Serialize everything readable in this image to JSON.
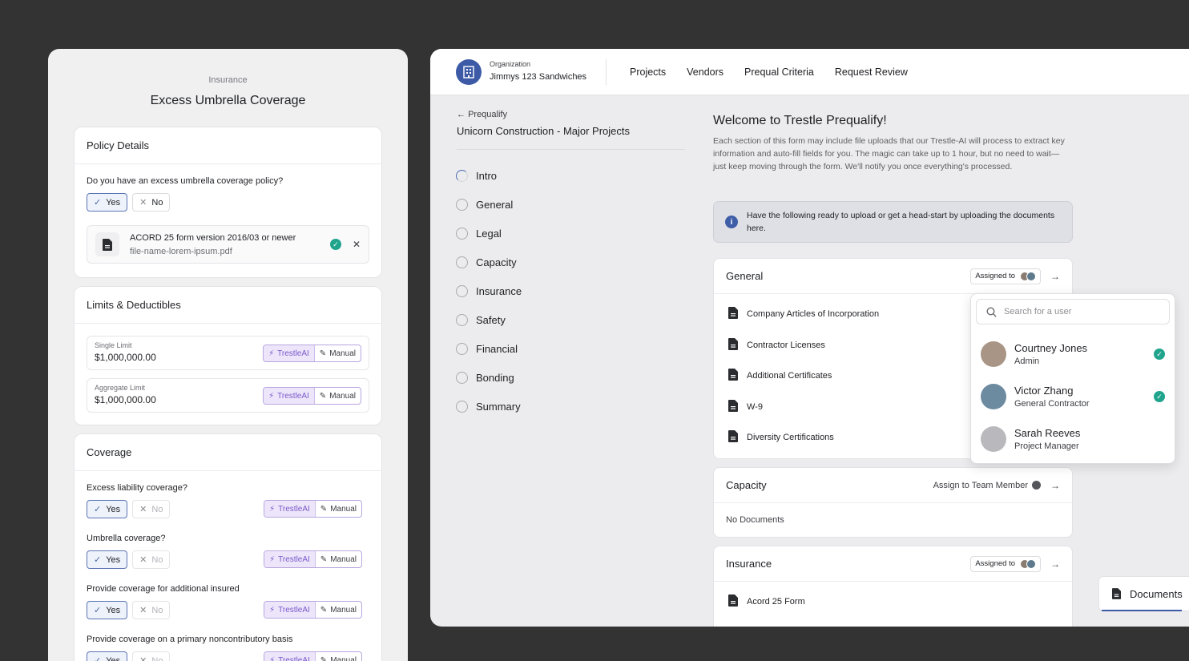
{
  "left": {
    "eyebrow": "Insurance",
    "title": "Excess Umbrella Coverage",
    "policy": {
      "heading": "Policy Details",
      "question": "Do you have an excess umbrella coverage policy?",
      "yes": "Yes",
      "no": "No",
      "file_title": "ACORD 25 form version 2016/03 or newer",
      "file_name": "file-name-lorem-ipsum.pdf"
    },
    "limits": {
      "heading": "Limits & Deductibles",
      "single_label": "Single Limit",
      "single_value": "$1,000,000.00",
      "aggregate_label": "Aggregate Limit",
      "aggregate_value": "$1,000,000.00"
    },
    "toggle": {
      "ai": "TrestleAI",
      "manual": "Manual"
    },
    "coverage": {
      "heading": "Coverage",
      "questions": [
        "Excess liability coverage?",
        "Umbrella coverage?",
        "Provide coverage for additional insured",
        "Provide coverage on a primary noncontributory basis"
      ]
    }
  },
  "topbar": {
    "org_label": "Organization",
    "org_name": "Jimmys 123 Sandwiches",
    "nav": [
      "Projects",
      "Vendors",
      "Prequal Criteria",
      "Request Review"
    ]
  },
  "sidebar": {
    "back": "Prequalify",
    "project": "Unicorn Construction - Major Projects",
    "steps": [
      "Intro",
      "General",
      "Legal",
      "Capacity",
      "Insurance",
      "Safety",
      "Financial",
      "Bonding",
      "Summary"
    ]
  },
  "main": {
    "welcome_title": "Welcome to Trestle Prequalify!",
    "welcome_body": "Each section of this form may include file uploads that our Trestle-AI will process to extract key information and auto-fill fields for you. The magic can take up to 1 hour, but no need to wait—just keep moving through the form. We'll notify you once everything's processed.",
    "info": "Have the following ready to upload or get a head-start by uploading the documents here.",
    "assigned_to": "Assigned to",
    "assign_team": "Assign to Team Member",
    "general": {
      "title": "General",
      "docs": [
        "Company Articles of Incorporation",
        "Contractor Licenses",
        "Additional Certificates",
        "W-9",
        "Diversity Certifications"
      ]
    },
    "capacity": {
      "title": "Capacity",
      "empty": "No Documents"
    },
    "insurance": {
      "title": "Insurance",
      "docs": [
        "Acord 25 Form"
      ]
    }
  },
  "popover": {
    "search_placeholder": "Search for a user",
    "users": [
      {
        "name": "Courtney Jones",
        "role": "Admin",
        "checked": true
      },
      {
        "name": "Victor Zhang",
        "role": "General Contractor",
        "checked": true
      },
      {
        "name": "Sarah Reeves",
        "role": "Project Manager",
        "checked": false
      }
    ]
  },
  "docs_tab": "Documents",
  "colors": {
    "accent": "#3c5aa6",
    "ai_purple": "#7a58c9",
    "success": "#20a48c"
  },
  "icons": [
    "building-icon",
    "doc-icon",
    "check-icon",
    "close-icon",
    "bolt-icon",
    "edit-icon",
    "info-icon",
    "search-icon",
    "arrow-right-icon",
    "arrow-left-icon",
    "person-icon"
  ]
}
